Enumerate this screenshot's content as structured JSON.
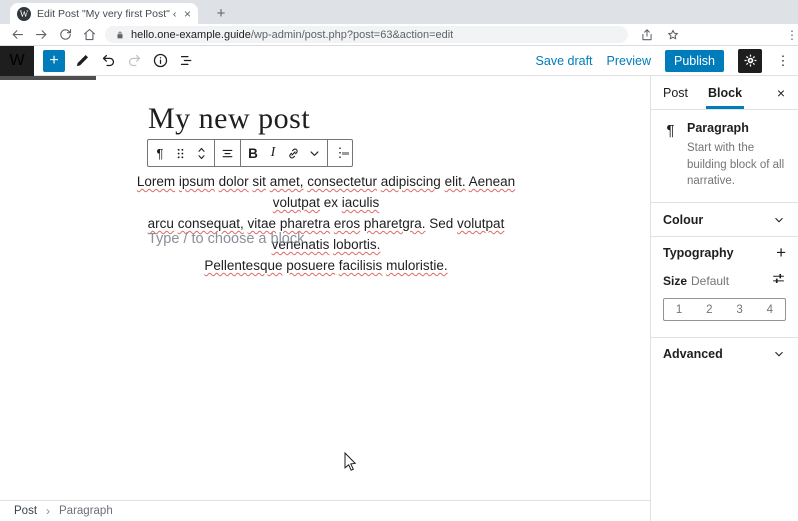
{
  "browser": {
    "tab_title": "Edit Post \"My very first Post\" ‹ on",
    "url_domain": "hello.one-example.guide",
    "url_path": "/wp-admin/post.php?post=63&action=edit"
  },
  "editor_header": {
    "save_draft_label": "Save draft",
    "preview_label": "Preview",
    "publish_label": "Publish"
  },
  "canvas": {
    "post_title": "My new post",
    "toolbar_buttons": [
      "paragraph-icon",
      "drag-handle-icon",
      "move-up-down-icon",
      "align-center-icon",
      "bold-button",
      "italic-button",
      "link-icon",
      "chevron-down-icon",
      "kebab-icon"
    ],
    "bold_label": "B",
    "italic_label": "I",
    "paragraph_lines": [
      [
        [
          "Lorem",
          1
        ],
        [
          "ipsum",
          1
        ],
        [
          "dolor",
          1
        ],
        [
          "sit",
          1
        ],
        [
          "amet,",
          1
        ],
        [
          "consectetur",
          1
        ],
        [
          "adipiscing",
          1
        ],
        [
          "elit.",
          1
        ],
        [
          "Aenean",
          1
        ],
        [
          "volutpat",
          1
        ],
        [
          "ex",
          0
        ],
        [
          "iaculis",
          1
        ]
      ],
      [
        [
          "arcu",
          1
        ],
        [
          "consequat,",
          1
        ],
        [
          "vitae",
          1
        ],
        [
          "pharetra",
          1
        ],
        [
          "eros",
          1
        ],
        [
          "pharetgra.",
          1
        ],
        [
          "Sed",
          0
        ],
        [
          "volutpat",
          1
        ],
        [
          "venenatis",
          1
        ],
        [
          "lobortis.",
          1
        ]
      ],
      [
        [
          "Pellentesque",
          1
        ],
        [
          "posuere",
          1
        ],
        [
          "facilisis",
          1
        ],
        [
          "muloristie.",
          1
        ]
      ]
    ],
    "block_appender_placeholder": "Type / to choose a block"
  },
  "sidebar": {
    "tabs": {
      "post": "Post",
      "block": "Block",
      "active": "Block"
    },
    "block_card": {
      "title": "Paragraph",
      "description": "Start with the building block of all narrative."
    },
    "colour_panel_label": "Colour",
    "typography_panel_label": "Typography",
    "size": {
      "label": "Size",
      "value": "Default",
      "options": [
        "1",
        "2",
        "3",
        "4"
      ]
    },
    "advanced_panel_label": "Advanced"
  },
  "breadcrumb": {
    "items": [
      "Post",
      "Paragraph"
    ],
    "separator": "›"
  },
  "colors": {
    "accent": "#007cba",
    "chrome_tabstrip": "#dee1e6",
    "omnibox": "#f1f3f4",
    "wp_black": "#1e1e1e",
    "border": "#e0e0e0",
    "spellcheck_underline": "#dd6a66",
    "muted_text": "#757575"
  },
  "icons": {
    "wordpress-logo": "W",
    "tab-favicon-wordpress": "W",
    "tab-close-icon": "×",
    "new-tab-icon": "+",
    "back-icon": "svg",
    "forward-icon": "svg",
    "reload-icon": "svg",
    "home-icon": "svg",
    "lock-icon": "svg",
    "share-icon": "svg",
    "star-icon": "svg",
    "browser-kebab-icon": "⋮",
    "plus-icon": "+",
    "pencil-icon": "svg",
    "undo-icon": "svg",
    "redo-icon": "svg",
    "info-icon": "svg",
    "list-view-icon": "svg",
    "gear-icon": "svg",
    "options-kebab-icon": "⋮",
    "paragraph-icon": "¶",
    "drag-handle-icon": "svg",
    "move-up-down-icon": "svg",
    "align-center-icon": "svg",
    "link-icon": "svg",
    "chevron-down-icon": "svg",
    "toolbar-kebab-icon": "⋮",
    "close-icon": "×",
    "sliders-icon": "svg",
    "mouse-cursor": "svg"
  }
}
